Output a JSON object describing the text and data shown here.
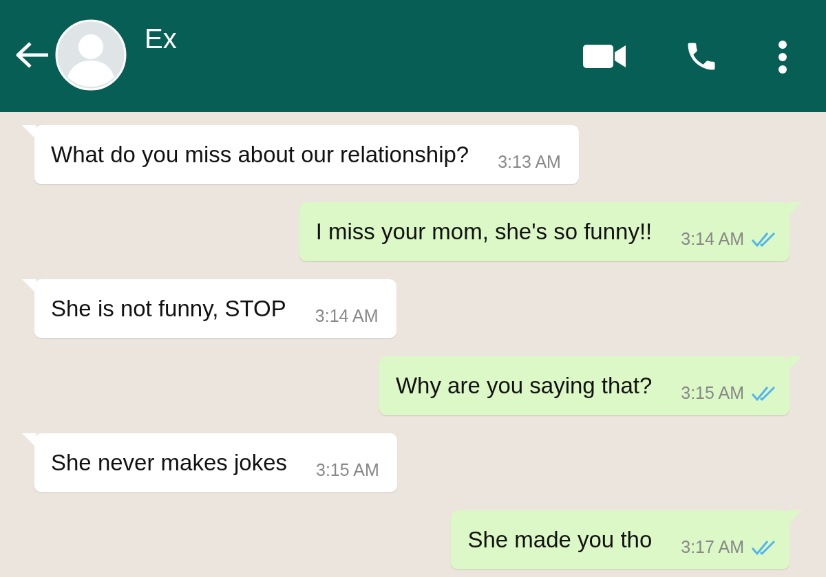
{
  "header": {
    "contact_name": "Ex"
  },
  "messages": [
    {
      "kind": "incoming",
      "text": "What do you miss about our relationship?",
      "time": "3:13 AM"
    },
    {
      "kind": "outgoing",
      "text": "I miss your mom, she's so funny!!",
      "time": "3:14 AM",
      "read": true
    },
    {
      "kind": "incoming",
      "text": "She is not funny, STOP",
      "time": "3:14 AM"
    },
    {
      "kind": "outgoing",
      "text": "Why are you saying that?",
      "time": "3:15 AM",
      "read": true
    },
    {
      "kind": "incoming",
      "text": "She never makes jokes",
      "time": "3:15 AM"
    },
    {
      "kind": "outgoing",
      "text": "She made you tho",
      "time": "3:17 AM",
      "read": true
    }
  ]
}
